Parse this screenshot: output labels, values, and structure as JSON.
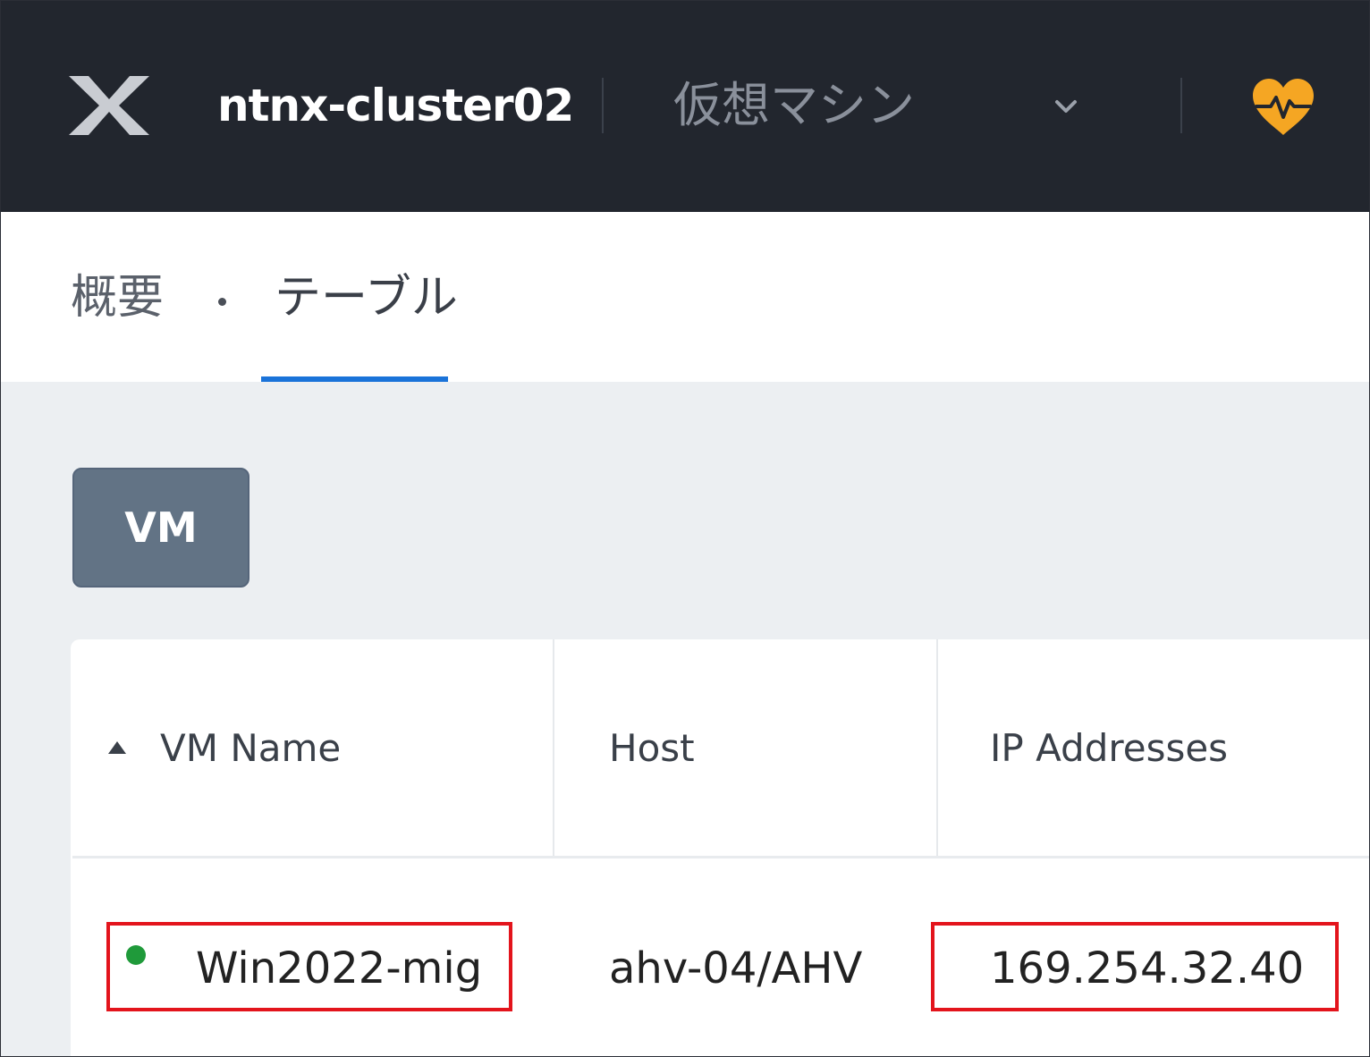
{
  "header": {
    "cluster_name": "ntnx-cluster02",
    "entity_selector": "仮想マシン",
    "icons": [
      "nutanix-logo",
      "chevron-down-icon",
      "health-heart-icon"
    ],
    "colors": {
      "topbar": "#22262e",
      "health": "#f5a623"
    }
  },
  "tabs": [
    {
      "label": "概要",
      "active": false
    },
    {
      "label": "テーブル",
      "active": true
    }
  ],
  "toolbar": {
    "vm_button": "VM"
  },
  "table": {
    "columns": [
      "VM Name",
      "Host",
      "IP Addresses"
    ],
    "sort": {
      "column": "VM Name",
      "direction": "ascending"
    },
    "rows": [
      {
        "vm_name": "Win2022-mig",
        "status": "on",
        "host": "ahv-04/AHV",
        "ip": "169.254.32.40"
      }
    ]
  }
}
